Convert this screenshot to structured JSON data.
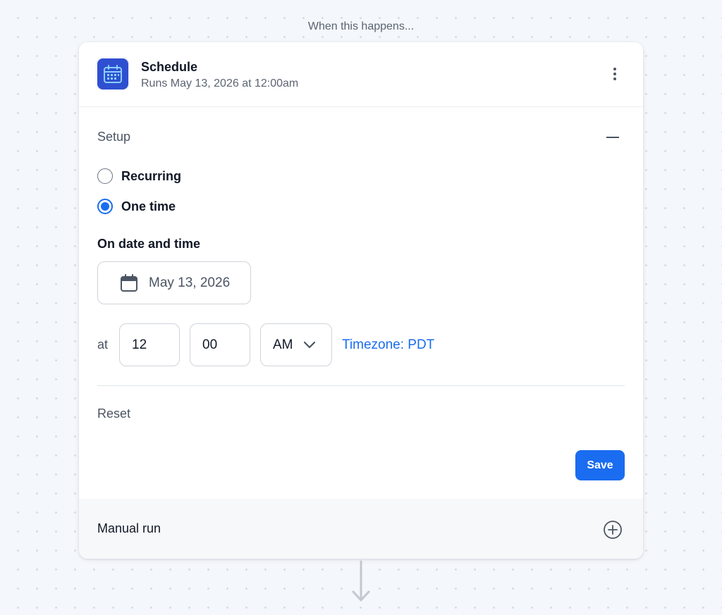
{
  "canvas": {
    "caption": "When this happens..."
  },
  "trigger": {
    "icon": "calendar-icon",
    "title": "Schedule",
    "subtitle": "Runs May 13, 2026 at 12:00am",
    "menu_icon": "more-vertical-icon"
  },
  "setup": {
    "title": "Setup",
    "collapse_icon": "minus-icon",
    "options": [
      {
        "label": "Recurring",
        "selected": false
      },
      {
        "label": "One time",
        "selected": true
      }
    ],
    "date_label": "On date and time",
    "date_icon": "calendar-icon",
    "date_value": "May 13, 2026",
    "at_label": "at",
    "hour": "12",
    "minute": "00",
    "ampm": "AM",
    "ampm_icon": "chevron-down-icon",
    "timezone": "Timezone: PDT",
    "reset_label": "Reset",
    "save_label": "Save"
  },
  "manual_run": {
    "label": "Manual run",
    "icon": "plus-circle-icon"
  },
  "connector": {
    "icon": "arrow-down-icon"
  },
  "colors": {
    "accent": "#1a6cf0",
    "app_icon_bg": "#2f4fd1"
  }
}
